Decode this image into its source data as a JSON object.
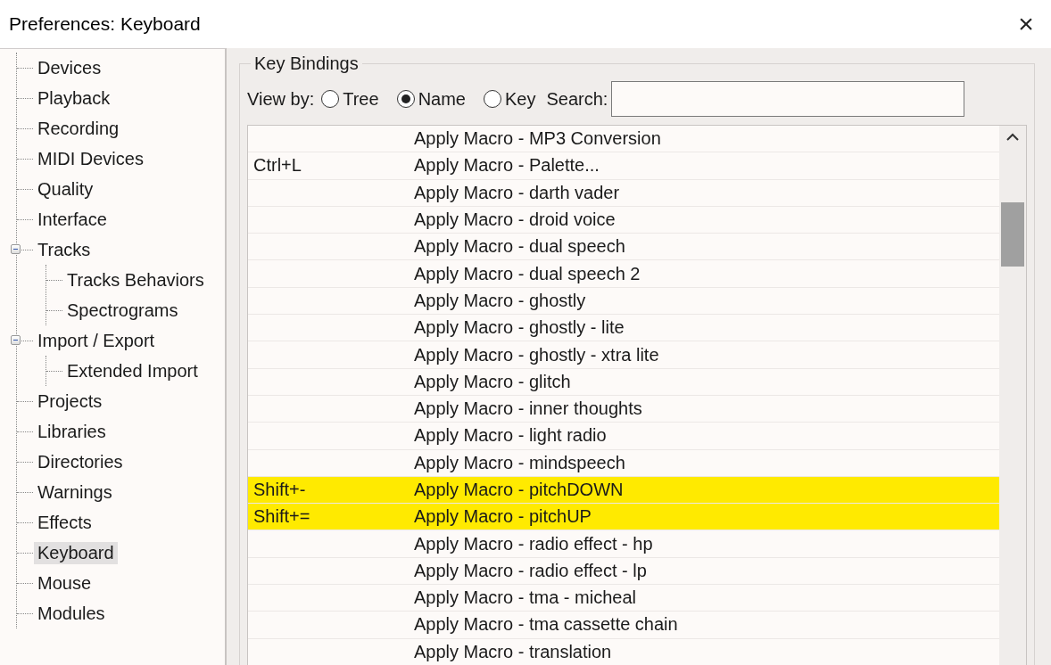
{
  "window": {
    "title": "Preferences: Keyboard",
    "close": "×"
  },
  "sidebar": {
    "items": [
      {
        "label": "Devices",
        "selected": false
      },
      {
        "label": "Playback",
        "selected": false
      },
      {
        "label": "Recording",
        "selected": false
      },
      {
        "label": "MIDI Devices",
        "selected": false
      },
      {
        "label": "Quality",
        "selected": false
      },
      {
        "label": "Interface",
        "selected": false
      },
      {
        "label": "Tracks",
        "selected": false,
        "expanded": true,
        "children": [
          {
            "label": "Tracks Behaviors",
            "selected": false
          },
          {
            "label": "Spectrograms",
            "selected": false
          }
        ]
      },
      {
        "label": "Import / Export",
        "selected": false,
        "expanded": true,
        "children": [
          {
            "label": "Extended Import",
            "selected": false
          }
        ]
      },
      {
        "label": "Projects",
        "selected": false
      },
      {
        "label": "Libraries",
        "selected": false
      },
      {
        "label": "Directories",
        "selected": false
      },
      {
        "label": "Warnings",
        "selected": false
      },
      {
        "label": "Effects",
        "selected": false
      },
      {
        "label": "Keyboard",
        "selected": true
      },
      {
        "label": "Mouse",
        "selected": false
      },
      {
        "label": "Modules",
        "selected": false
      }
    ]
  },
  "key_bindings": {
    "title": "Key Bindings",
    "view_by_label": "View by:",
    "view_options": [
      {
        "label": "Tree",
        "selected": false
      },
      {
        "label": "Name",
        "selected": true
      },
      {
        "label": "Key",
        "selected": false
      }
    ],
    "search": {
      "label": "Search:"
    },
    "rows": [
      {
        "key": "",
        "name": "Apply Macro - MP3 Conversion",
        "highlighted": false
      },
      {
        "key": "Ctrl+L",
        "name": "Apply Macro - Palette...",
        "highlighted": false
      },
      {
        "key": "",
        "name": "Apply Macro - darth vader",
        "highlighted": false
      },
      {
        "key": "",
        "name": "Apply Macro - droid voice",
        "highlighted": false
      },
      {
        "key": "",
        "name": "Apply Macro - dual speech",
        "highlighted": false
      },
      {
        "key": "",
        "name": "Apply Macro - dual speech 2",
        "highlighted": false
      },
      {
        "key": "",
        "name": "Apply Macro - ghostly",
        "highlighted": false
      },
      {
        "key": "",
        "name": "Apply Macro - ghostly - lite",
        "highlighted": false
      },
      {
        "key": "",
        "name": "Apply Macro - ghostly - xtra lite",
        "highlighted": false
      },
      {
        "key": "",
        "name": "Apply Macro - glitch",
        "highlighted": false
      },
      {
        "key": "",
        "name": "Apply Macro - inner thoughts",
        "highlighted": false
      },
      {
        "key": "",
        "name": "Apply Macro - light radio",
        "highlighted": false
      },
      {
        "key": "",
        "name": "Apply Macro - mindspeech",
        "highlighted": false
      },
      {
        "key": "Shift+-",
        "name": "Apply Macro - pitchDOWN",
        "highlighted": true
      },
      {
        "key": "Shift+=",
        "name": "Apply Macro - pitchUP",
        "highlighted": true
      },
      {
        "key": "",
        "name": "Apply Macro - radio effect - hp",
        "highlighted": false
      },
      {
        "key": "",
        "name": "Apply Macro - radio effect - lp",
        "highlighted": false
      },
      {
        "key": "",
        "name": "Apply Macro - tma - micheal",
        "highlighted": false
      },
      {
        "key": "",
        "name": "Apply Macro - tma cassette chain",
        "highlighted": false
      },
      {
        "key": "",
        "name": "Apply Macro - translation",
        "highlighted": false
      }
    ]
  }
}
